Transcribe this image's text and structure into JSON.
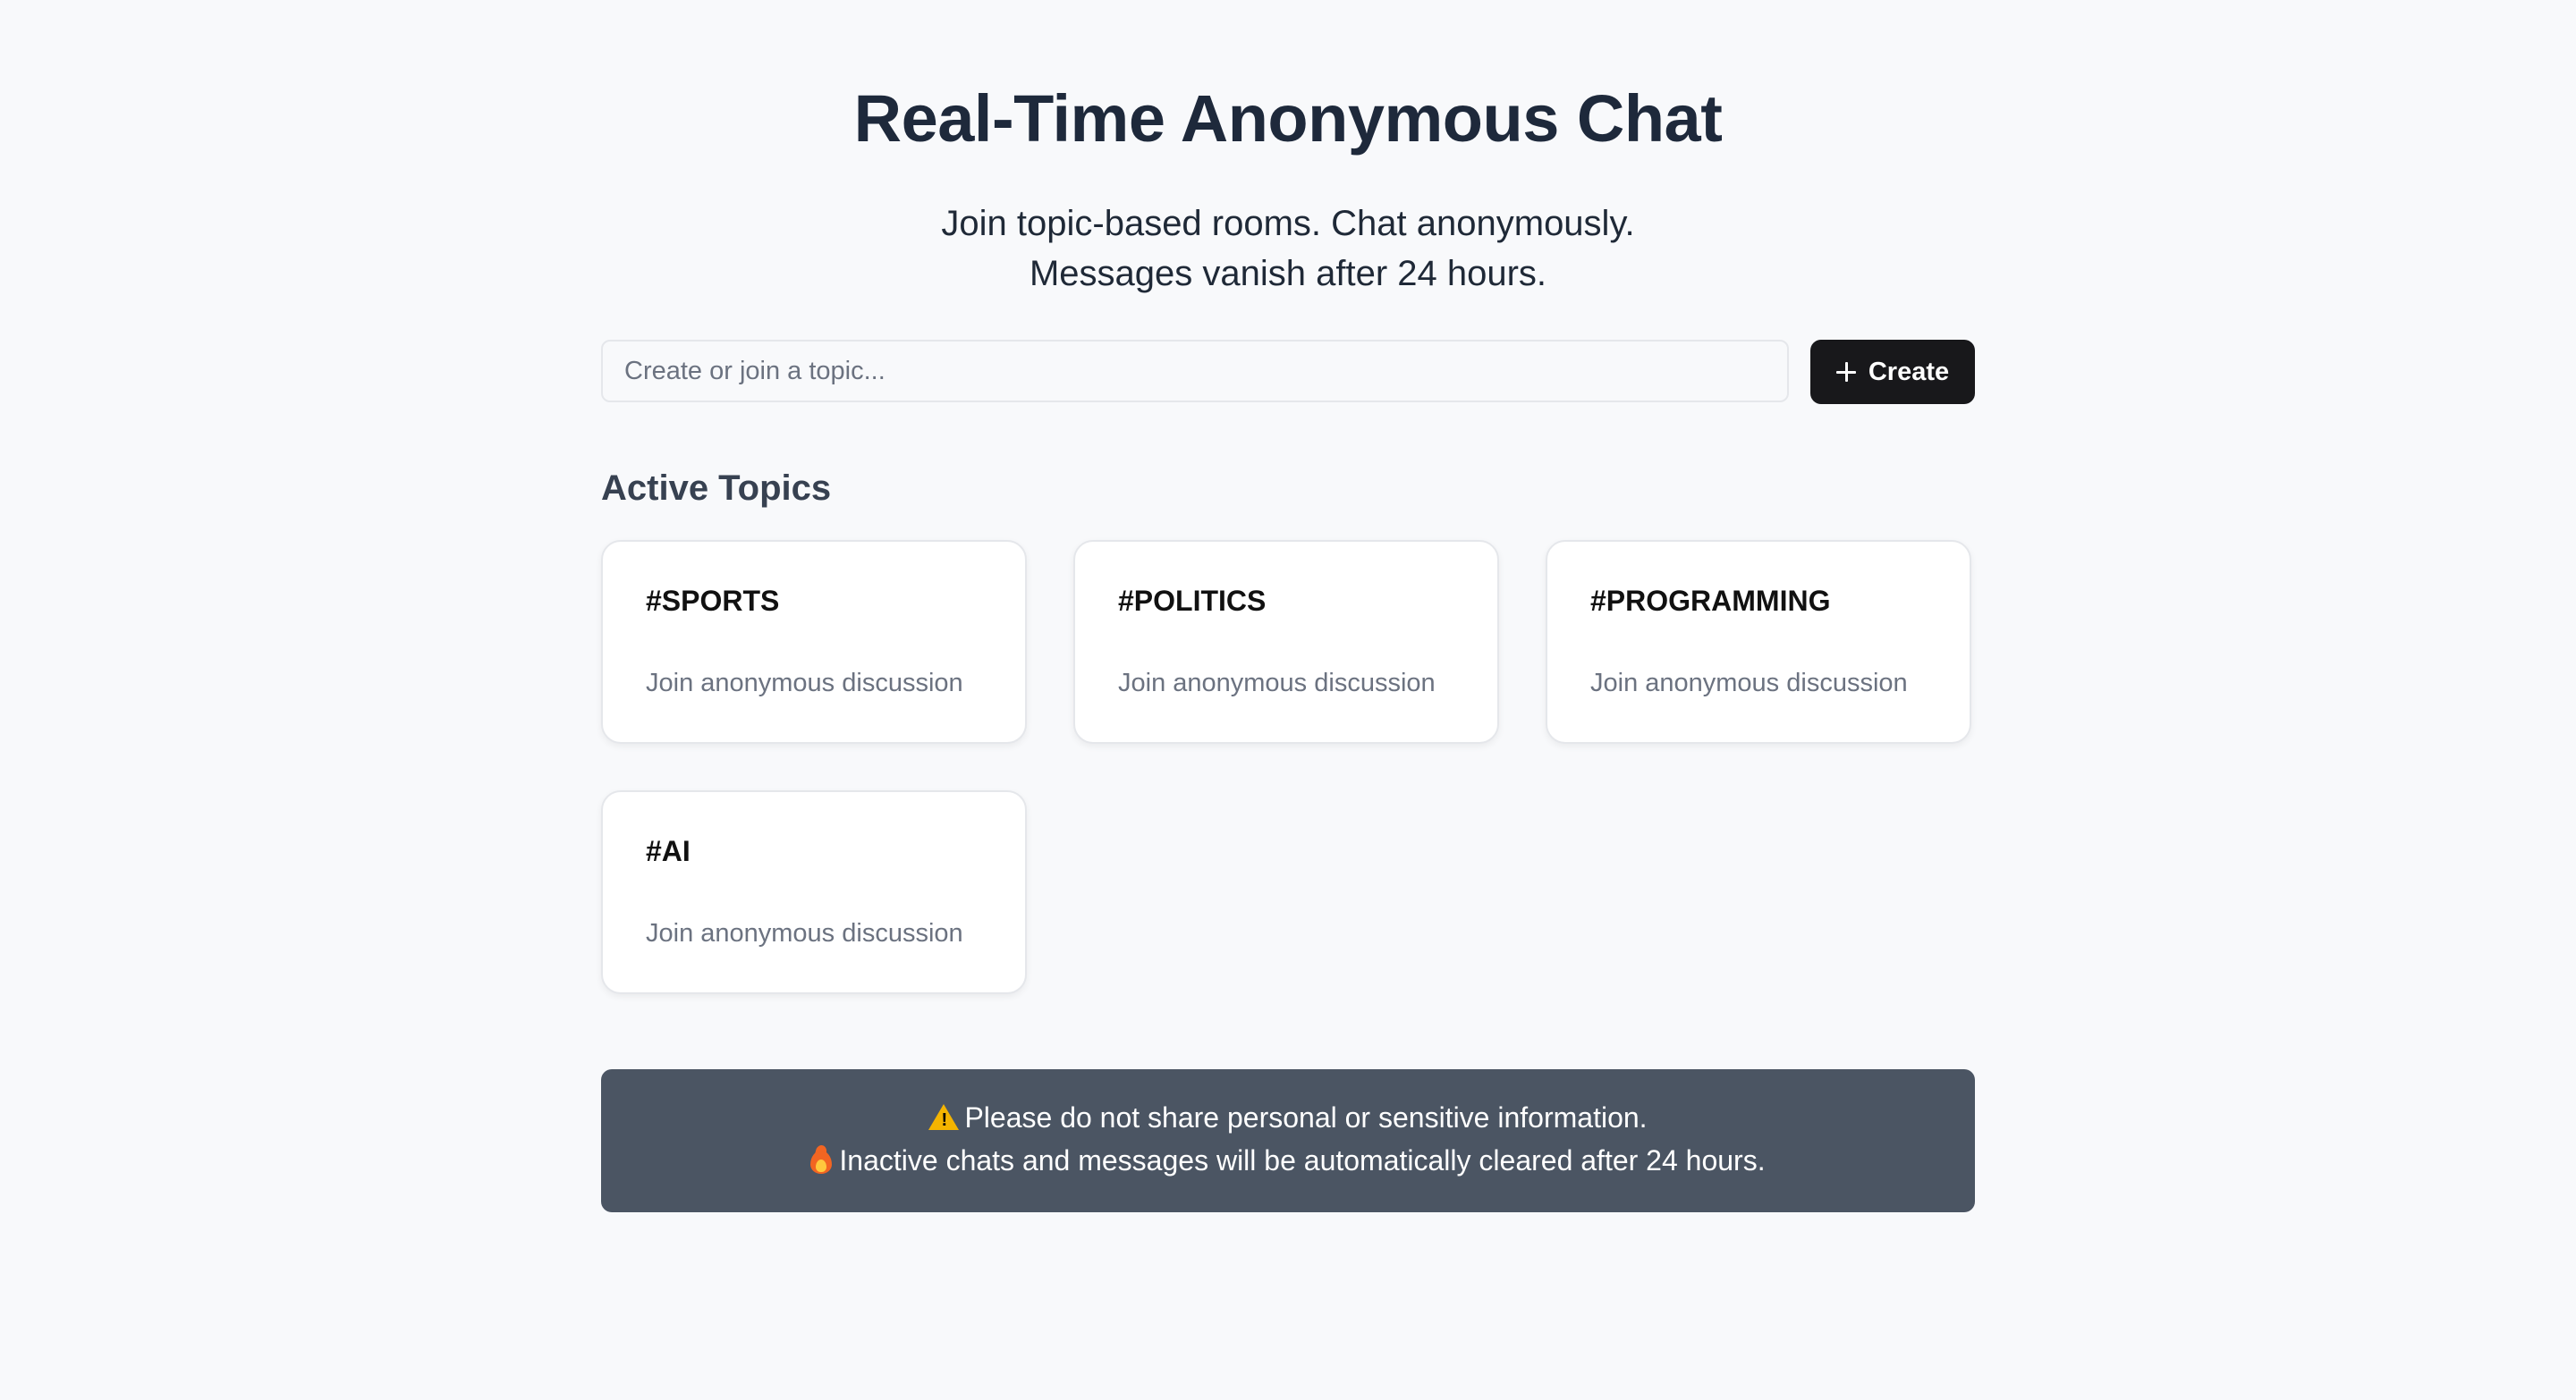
{
  "header": {
    "title": "Real-Time Anonymous Chat",
    "subtitle_line1": "Join topic-based rooms. Chat anonymously.",
    "subtitle_line2": "Messages vanish after 24 hours."
  },
  "topic_form": {
    "input_placeholder": "Create or join a topic...",
    "input_value": "",
    "create_label": "Create",
    "create_icon": "plus-icon"
  },
  "active_topics": {
    "heading": "Active Topics",
    "cards": [
      {
        "title": "#SPORTS",
        "description": "Join anonymous discussion"
      },
      {
        "title": "#POLITICS",
        "description": "Join anonymous discussion"
      },
      {
        "title": "#PROGRAMMING",
        "description": "Join anonymous discussion"
      },
      {
        "title": "#AI",
        "description": "Join anonymous discussion"
      }
    ]
  },
  "notice": {
    "line1_icon": "warning-icon",
    "line1": "Please do not share personal or sensitive information.",
    "line2_icon": "fire-icon",
    "line2": "Inactive chats and messages will be automatically cleared after 24 hours."
  },
  "colors": {
    "background": "#f8f9fb",
    "create_button": "#18181b",
    "notice_background": "#4b5563",
    "card_border": "#e5e7eb"
  }
}
